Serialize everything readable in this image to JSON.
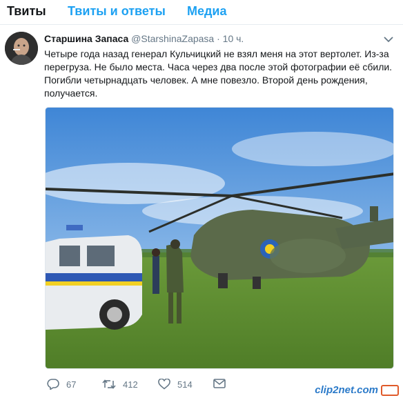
{
  "tabs": [
    {
      "label": "Твиты",
      "active": true
    },
    {
      "label": "Твиты и ответы",
      "active": false
    },
    {
      "label": "Медиа",
      "active": false
    }
  ],
  "tweet": {
    "author_name": "Старшина Запаса",
    "author_handle": "@StarshinaZapasa",
    "separator": "·",
    "time": "10 ч.",
    "text": "Четыре года назад генерал Кульчицкий не взял меня на этот вертолет. Из-за перегруза. Не было места. Часа через два после этой фотографии её сбили. Погибли четырнадцать человек. А мне повезло. Второй день рождения, получается.",
    "actions": {
      "replies": "67",
      "retweets": "412",
      "likes": "514"
    }
  },
  "watermark": "clip2net.com",
  "colors": {
    "accent": "#1da1f2",
    "text": "#14171a",
    "muted": "#657786"
  }
}
